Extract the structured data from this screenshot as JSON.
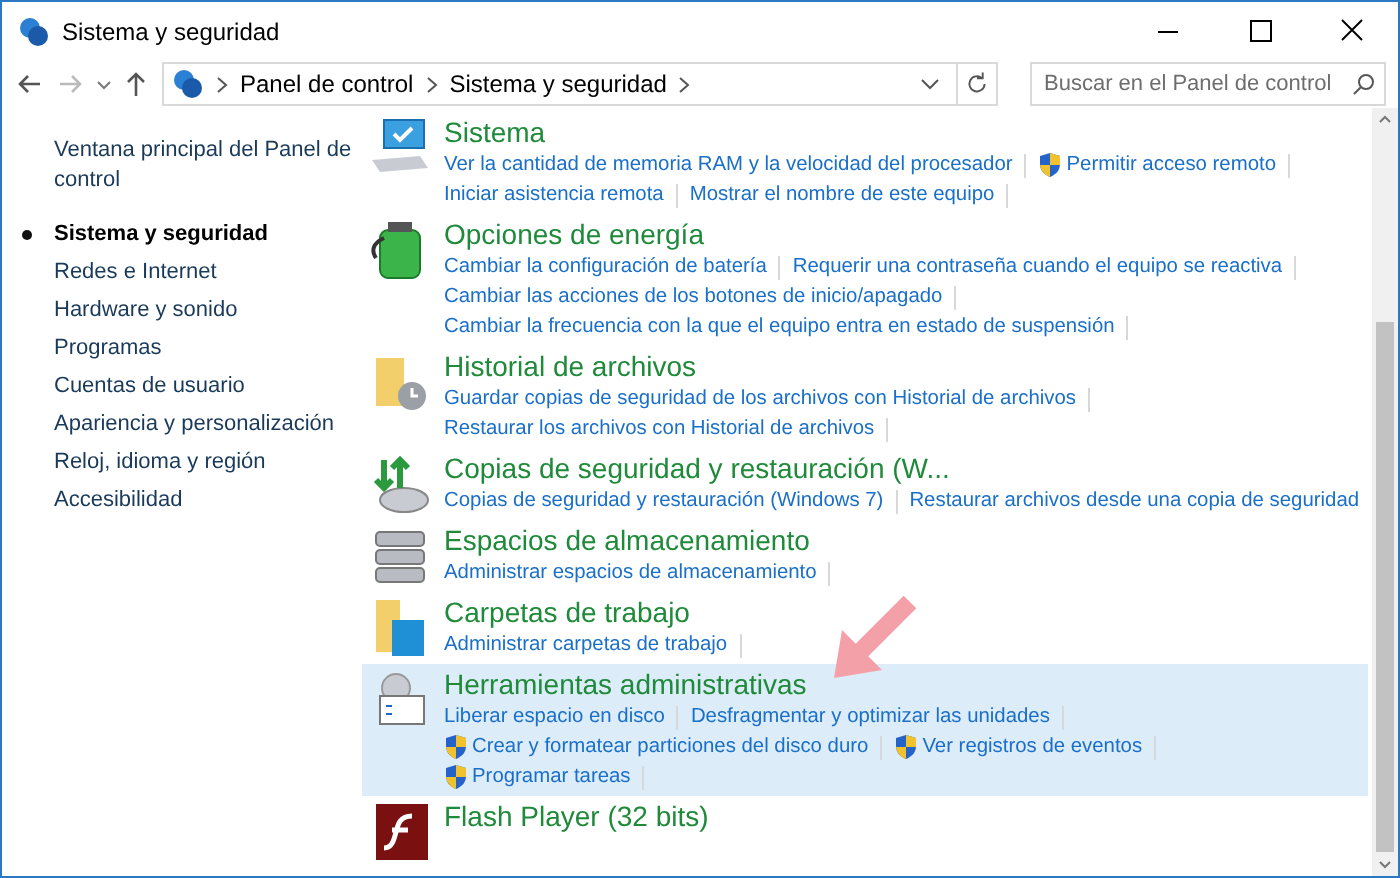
{
  "window": {
    "title": "Sistema y seguridad"
  },
  "address_bar": {
    "crumbs": [
      "Panel de control",
      "Sistema y seguridad"
    ]
  },
  "search": {
    "placeholder": "Buscar en el Panel de control"
  },
  "sidebar": {
    "items": [
      {
        "label": "Ventana principal del Panel de control",
        "selected": false
      },
      {
        "label": "Sistema y seguridad",
        "selected": true
      },
      {
        "label": "Redes e Internet",
        "selected": false
      },
      {
        "label": "Hardware y sonido",
        "selected": false
      },
      {
        "label": "Programas",
        "selected": false
      },
      {
        "label": "Cuentas de usuario",
        "selected": false
      },
      {
        "label": "Apariencia y personalización",
        "selected": false
      },
      {
        "label": "Reloj, idioma y región",
        "selected": false
      },
      {
        "label": "Accesibilidad",
        "selected": false
      }
    ]
  },
  "categories": [
    {
      "kind": "system",
      "title": "Sistema",
      "selected": false,
      "lines": [
        [
          {
            "label": "Ver la cantidad de memoria RAM y la velocidad del procesador",
            "shield": false
          },
          {
            "label": "Permitir acceso remoto",
            "shield": true
          }
        ],
        [
          {
            "label": "Iniciar asistencia remota",
            "shield": false
          },
          {
            "label": "Mostrar el nombre de este equipo",
            "shield": false
          }
        ]
      ]
    },
    {
      "kind": "power",
      "title": "Opciones de energía",
      "selected": false,
      "lines": [
        [
          {
            "label": "Cambiar la configuración de batería",
            "shield": false
          },
          {
            "label": "Requerir una contraseña cuando el equipo se reactiva",
            "shield": false
          }
        ],
        [
          {
            "label": "Cambiar las acciones de los botones de inicio/apagado",
            "shield": false
          }
        ],
        [
          {
            "label": "Cambiar la frecuencia con la que el equipo entra en estado de suspensión",
            "shield": false
          }
        ]
      ]
    },
    {
      "kind": "history",
      "title": "Historial de archivos",
      "selected": false,
      "lines": [
        [
          {
            "label": "Guardar copias de seguridad de los archivos con Historial de archivos",
            "shield": false
          }
        ],
        [
          {
            "label": "Restaurar los archivos con Historial de archivos",
            "shield": false
          }
        ]
      ]
    },
    {
      "kind": "backup",
      "title": "Copias de seguridad y restauración (W...",
      "selected": false,
      "lines": [
        [
          {
            "label": "Copias de seguridad y restauración (Windows 7)",
            "shield": false
          },
          {
            "label": "Restaurar archivos desde una copia de seguridad",
            "shield": false
          }
        ]
      ]
    },
    {
      "kind": "storage",
      "title": "Espacios de almacenamiento",
      "selected": false,
      "lines": [
        [
          {
            "label": "Administrar espacios de almacenamiento",
            "shield": false
          }
        ]
      ]
    },
    {
      "kind": "workfolders",
      "title": "Carpetas de trabajo",
      "selected": false,
      "lines": [
        [
          {
            "label": "Administrar carpetas de trabajo",
            "shield": false
          }
        ]
      ]
    },
    {
      "kind": "admin",
      "title": "Herramientas administrativas",
      "selected": true,
      "lines": [
        [
          {
            "label": "Liberar espacio en disco",
            "shield": false
          },
          {
            "label": "Desfragmentar y optimizar las unidades",
            "shield": false
          }
        ],
        [
          {
            "label": "Crear y formatear particiones del disco duro",
            "shield": true
          },
          {
            "label": "Ver registros de eventos",
            "shield": true
          }
        ],
        [
          {
            "label": "Programar tareas",
            "shield": true
          }
        ]
      ]
    },
    {
      "kind": "flash",
      "title": "Flash Player (32 bits)",
      "selected": false
    }
  ]
}
